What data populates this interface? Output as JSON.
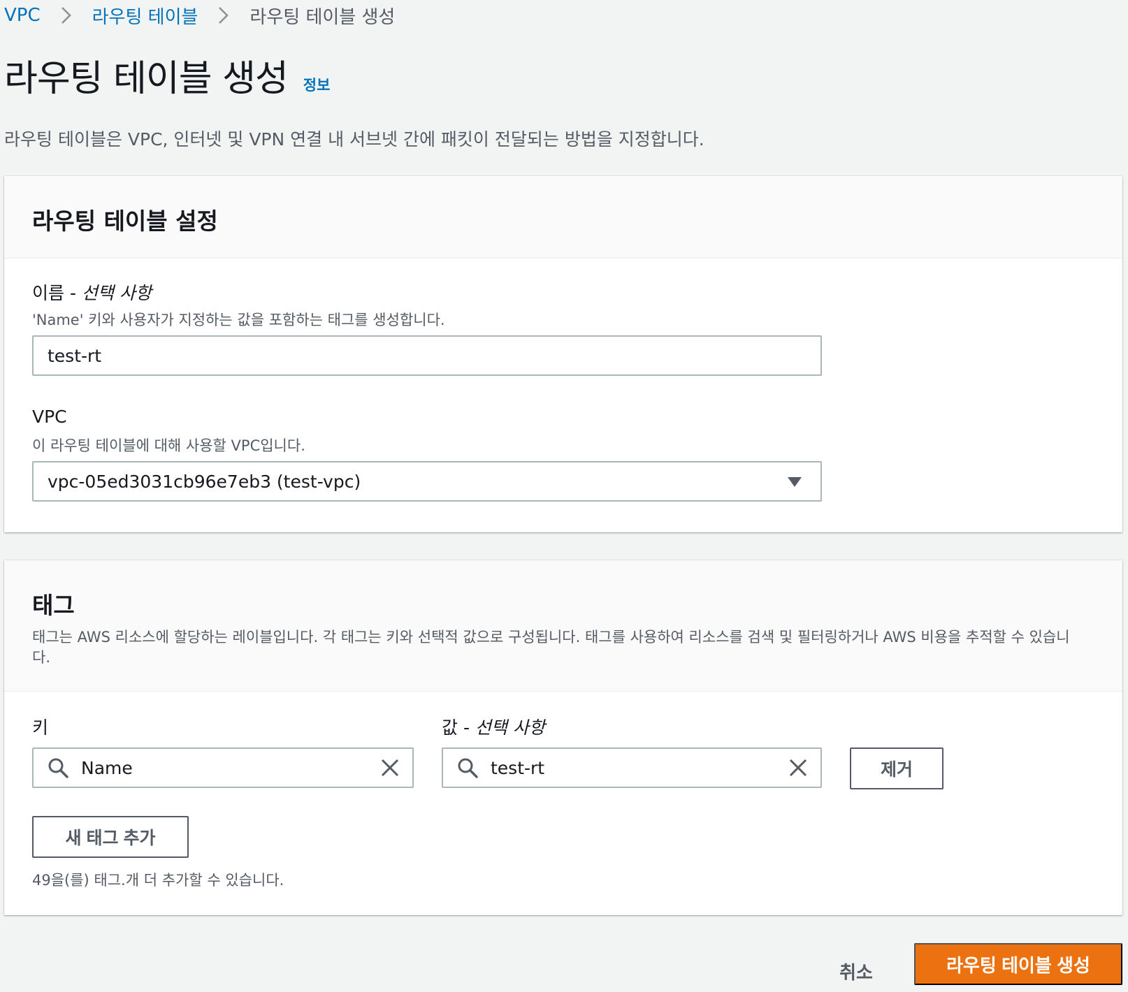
{
  "breadcrumb": {
    "items": [
      "VPC",
      "라우팅 테이블",
      "라우팅 테이블 생성"
    ]
  },
  "page": {
    "title": "라우팅 테이블 생성",
    "info_link": "정보",
    "description": "라우팅 테이블은 VPC, 인터넷 및 VPN 연결 내 서브넷 간에 패킷이 전달되는 방법을 지정합니다."
  },
  "settings": {
    "title": "라우팅 테이블 설정",
    "name_label": "이름 - ",
    "name_optional": "선택 사항",
    "name_hint": "'Name' 키와 사용자가 지정하는 값을 포함하는 태그를 생성합니다.",
    "name_value": "test-rt",
    "vpc_label": "VPC",
    "vpc_hint": "이 라우팅 테이블에 대해 사용할 VPC입니다.",
    "vpc_value": "vpc-05ed3031cb96e7eb3 (test-vpc)"
  },
  "tags": {
    "title": "태그",
    "description": "태그는 AWS 리소스에 할당하는 레이블입니다. 각 태그는 키와 선택적 값으로 구성됩니다. 태그를 사용하여 리소스를 검색 및 필터링하거나 AWS 비용을 추적할 수 있습니다.",
    "key_label": "키",
    "value_label": "값 - ",
    "value_optional": "선택 사항",
    "rows": [
      {
        "key": "Name",
        "value": "test-rt"
      }
    ],
    "remove_label": "제거",
    "add_label": "새 태그 추가",
    "limit_text": "49을(를) 태그.개 더 추가할 수 있습니다."
  },
  "footer": {
    "cancel_label": "취소",
    "create_label": "라우팅 테이블 생성"
  },
  "colors": {
    "link": "#0073bb",
    "primary": "#ec7211",
    "border": "#aab7b8",
    "background": "#f2f3f3"
  },
  "icons": [
    "chevron-right-icon",
    "search-icon",
    "clear-icon",
    "caret-down-icon"
  ]
}
